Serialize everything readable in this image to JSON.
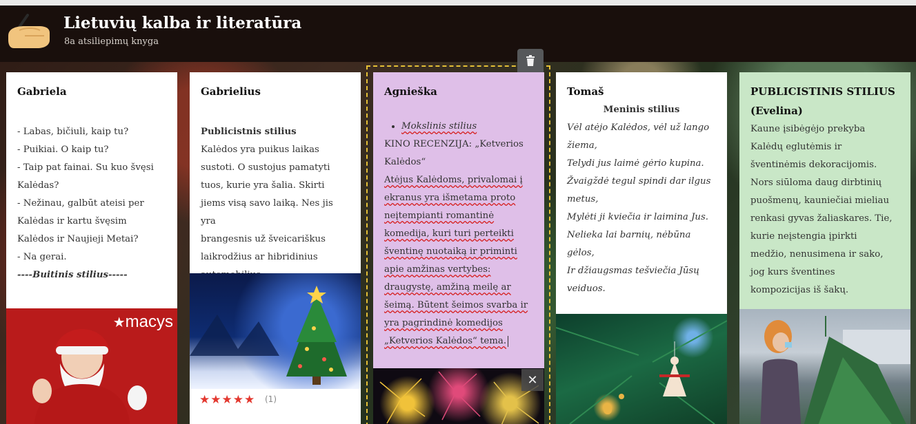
{
  "header": {
    "title": "Lietuvių kalba ir literatūra",
    "subtitle": "8a atsiliepimų knyga"
  },
  "colors": {
    "header_bg": "#190f0c",
    "lilac_card": "#dfbfe8",
    "green_card": "#c9e7c7",
    "selection_dash": "#e5c036",
    "star_color": "#e3382f"
  },
  "cards": [
    {
      "author": "Gabriela",
      "lines": [
        "- Labas, bičiuli, kaip tu?",
        "- Puikiai. O kaip tu?",
        "- Taip pat fainai. Su kuo švęsi",
        "Kalėdas?",
        "- Nežinau, galbūt ateisi per",
        "Kalėdas ir kartu švęsim",
        "Kalėdos ir Naujieji Metai?",
        "- Na gerai."
      ],
      "footer": "----Buitinis stilius-----",
      "image_label": "macys"
    },
    {
      "author": "Gabrielius",
      "heading": "Publicistnis stilius",
      "lines": [
        "Kalėdos yra puikus laikas",
        "sustoti. O sustojus pamatyti",
        "tuos, kurie yra šalia. Skirti",
        "jiems visą savo laiką. Nes jis yra",
        "brangesnis už šveicariškus",
        "laikrodžius ar hibridinius",
        "automobilius."
      ],
      "rating": {
        "stars": "★★★★★",
        "value": 5,
        "count": "(1)"
      }
    },
    {
      "author": "Agnieška",
      "bullet": "Mokslinis stilius",
      "lines": [
        "KINO RECENZIJA: „Ketverios",
        "Kalėdos“",
        "Atėjus Kalėdoms, privalomai į",
        "ekranus yra išmetama proto",
        "neįtempianti romantinė",
        "komedija, kuri turi perteikti",
        "šventinę nuotaiką ir priminti",
        "apie amžinas vertybes:",
        "draugystę, amžiną meilę ar",
        "šeimą. Būtent šeimos svarba ir",
        "yra pagrindinė komedijos",
        "„Ketverios Kalėdos“ tema."
      ],
      "close_label": "✕"
    },
    {
      "author": "Tomaš",
      "heading": "Meninis stilius",
      "lines": [
        "Vėl atėjo Kalėdos, vėl už lango",
        "žiema,",
        "Telydi jus laimė gėrio kupina.",
        "Žvaigždė tegul spindi dar ilgus",
        "metus,",
        "Mylėti ji kviečia ir laimina Jus.",
        "Nelieka lai barnių, nėbūna",
        "gėlos,",
        "Ir džiaugsmas tešviečia Jūsų",
        "veiduos."
      ]
    },
    {
      "author_lines": [
        "PUBLICISTINIS STILIUS",
        "(Evelina)"
      ],
      "lines": [
        "Kaune įsibėgėjo prekyba",
        "Kalėdų eglutėmis ir",
        "šventinėmis dekoracijomis.",
        "Nors siūloma daug dirbtinių",
        "puošmenų, kauniečiai mieliau",
        "renkasi gyvas žaliaskares. Tie,",
        "kurie neįstengia įpirkti",
        "medžio, nenusimena ir sako,",
        "jog kurs šventines",
        "kompozicijas iš šakų."
      ]
    }
  ],
  "icons": {
    "logo": "hand-writing-icon",
    "trash": "trash-icon",
    "close": "close-icon",
    "star": "star-icon"
  }
}
